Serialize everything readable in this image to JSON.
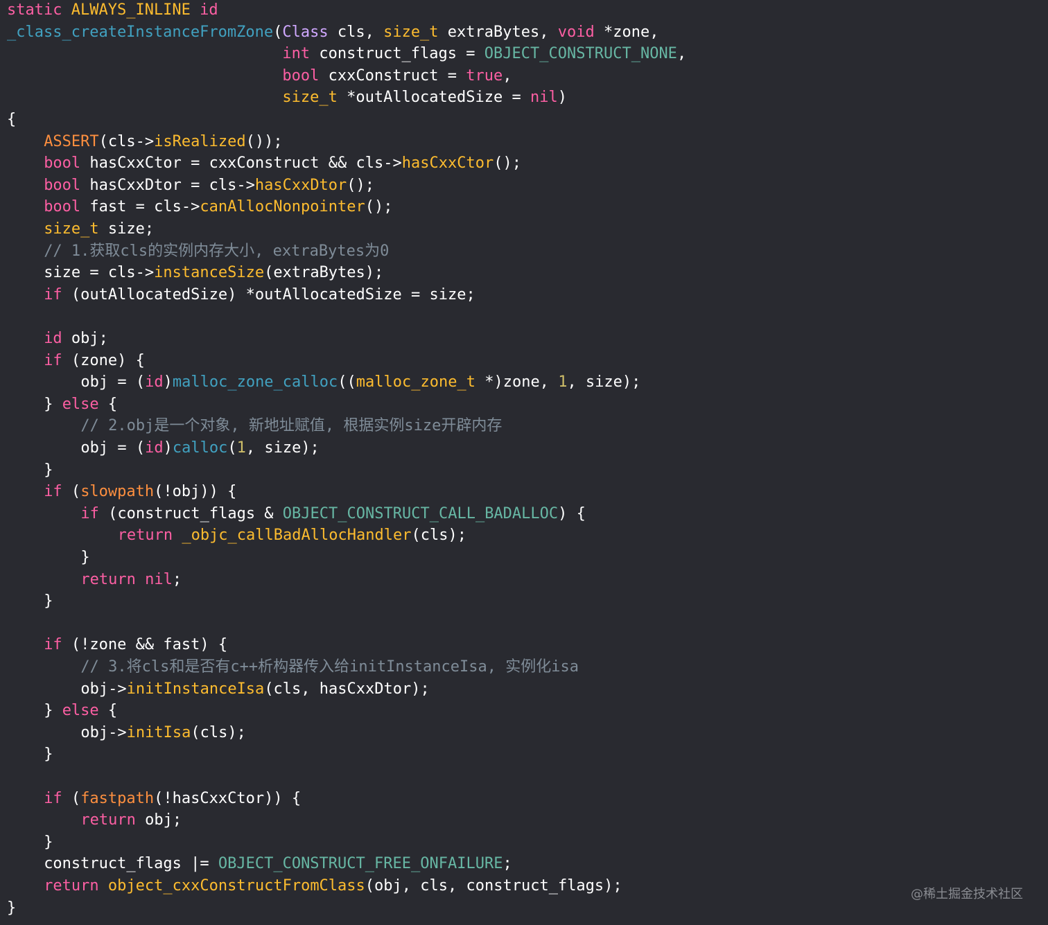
{
  "colors": {
    "background": "#292a30",
    "plain": "#ffffff",
    "keyword": "#fc5fa3",
    "type": "#fd8f3f",
    "function_decl": "#41a1c0",
    "class_name": "#d0a8ff",
    "macro": "#fd8f3f",
    "member_call": "#fdbc2f",
    "constant": "#67b7a4",
    "number": "#d0bf69",
    "comment": "#7f8c98",
    "libcall": "#67b7a4"
  },
  "code": {
    "lines": [
      {
        "indent": 0,
        "tokens": [
          [
            "static",
            "keyword"
          ],
          [
            " ",
            "plain"
          ],
          [
            "ALWAYS_INLINE",
            "member_call"
          ],
          [
            " ",
            "plain"
          ],
          [
            "id",
            "keyword"
          ]
        ]
      },
      {
        "indent": 0,
        "tokens": [
          [
            "_class_createInstanceFromZone",
            "function_decl"
          ],
          [
            "(",
            "plain"
          ],
          [
            "Class",
            "class_name"
          ],
          [
            " cls, ",
            "plain"
          ],
          [
            "size_t",
            "member_call"
          ],
          [
            " extraBytes, ",
            "plain"
          ],
          [
            "void",
            "keyword"
          ],
          [
            " *zone,",
            "plain"
          ]
        ]
      },
      {
        "indent": 0,
        "tokens": [
          [
            "                              ",
            "plain"
          ],
          [
            "int",
            "keyword"
          ],
          [
            " construct_flags = ",
            "plain"
          ],
          [
            "OBJECT_CONSTRUCT_NONE",
            "constant"
          ],
          [
            ",",
            "plain"
          ]
        ]
      },
      {
        "indent": 0,
        "tokens": [
          [
            "                              ",
            "plain"
          ],
          [
            "bool",
            "keyword"
          ],
          [
            " cxxConstruct = ",
            "plain"
          ],
          [
            "true",
            "keyword"
          ],
          [
            ",",
            "plain"
          ]
        ]
      },
      {
        "indent": 0,
        "tokens": [
          [
            "                              ",
            "plain"
          ],
          [
            "size_t",
            "member_call"
          ],
          [
            " *outAllocatedSize = ",
            "plain"
          ],
          [
            "nil",
            "keyword"
          ],
          [
            ")",
            "plain"
          ]
        ]
      },
      {
        "indent": 0,
        "tokens": [
          [
            "{",
            "plain"
          ]
        ]
      },
      {
        "indent": 1,
        "tokens": [
          [
            "ASSERT",
            "macro"
          ],
          [
            "(cls->",
            "plain"
          ],
          [
            "isRealized",
            "member_call"
          ],
          [
            "());",
            "plain"
          ]
        ]
      },
      {
        "indent": 1,
        "tokens": [
          [
            "bool",
            "keyword"
          ],
          [
            " hasCxxCtor = cxxConstruct && cls->",
            "plain"
          ],
          [
            "hasCxxCtor",
            "member_call"
          ],
          [
            "();",
            "plain"
          ]
        ]
      },
      {
        "indent": 1,
        "tokens": [
          [
            "bool",
            "keyword"
          ],
          [
            " hasCxxDtor = cls->",
            "plain"
          ],
          [
            "hasCxxDtor",
            "member_call"
          ],
          [
            "();",
            "plain"
          ]
        ]
      },
      {
        "indent": 1,
        "tokens": [
          [
            "bool",
            "keyword"
          ],
          [
            " fast = cls->",
            "plain"
          ],
          [
            "canAllocNonpointer",
            "member_call"
          ],
          [
            "();",
            "plain"
          ]
        ]
      },
      {
        "indent": 1,
        "tokens": [
          [
            "size_t",
            "member_call"
          ],
          [
            " size;",
            "plain"
          ]
        ]
      },
      {
        "indent": 1,
        "tokens": [
          [
            "// 1.获取cls的实例内存大小, extraBytes为0",
            "comment"
          ]
        ]
      },
      {
        "indent": 1,
        "tokens": [
          [
            "size = cls->",
            "plain"
          ],
          [
            "instanceSize",
            "member_call"
          ],
          [
            "(extraBytes);",
            "plain"
          ]
        ]
      },
      {
        "indent": 1,
        "tokens": [
          [
            "if",
            "keyword"
          ],
          [
            " (outAllocatedSize) *outAllocatedSize = size;",
            "plain"
          ]
        ]
      },
      {
        "indent": 0,
        "tokens": []
      },
      {
        "indent": 1,
        "tokens": [
          [
            "id",
            "keyword"
          ],
          [
            " obj;",
            "plain"
          ]
        ]
      },
      {
        "indent": 1,
        "tokens": [
          [
            "if",
            "keyword"
          ],
          [
            " (zone) {",
            "plain"
          ]
        ]
      },
      {
        "indent": 2,
        "tokens": [
          [
            "obj = (",
            "plain"
          ],
          [
            "id",
            "keyword"
          ],
          [
            ")",
            "plain"
          ],
          [
            "malloc_zone_calloc",
            "function_decl"
          ],
          [
            "((",
            "plain"
          ],
          [
            "malloc_zone_t",
            "member_call"
          ],
          [
            " *)zone, ",
            "plain"
          ],
          [
            "1",
            "number"
          ],
          [
            ", size);",
            "plain"
          ]
        ]
      },
      {
        "indent": 1,
        "tokens": [
          [
            "} ",
            "plain"
          ],
          [
            "else",
            "keyword"
          ],
          [
            " {",
            "plain"
          ]
        ]
      },
      {
        "indent": 2,
        "tokens": [
          [
            "// 2.obj是一个对象, 新地址赋值, 根据实例size开辟内存",
            "comment"
          ]
        ]
      },
      {
        "indent": 2,
        "tokens": [
          [
            "obj = (",
            "plain"
          ],
          [
            "id",
            "keyword"
          ],
          [
            ")",
            "plain"
          ],
          [
            "calloc",
            "function_decl"
          ],
          [
            "(",
            "plain"
          ],
          [
            "1",
            "number"
          ],
          [
            ", size);",
            "plain"
          ]
        ]
      },
      {
        "indent": 1,
        "tokens": [
          [
            "}",
            "plain"
          ]
        ]
      },
      {
        "indent": 1,
        "tokens": [
          [
            "if",
            "keyword"
          ],
          [
            " (",
            "plain"
          ],
          [
            "slowpath",
            "macro"
          ],
          [
            "(!obj)) {",
            "plain"
          ]
        ]
      },
      {
        "indent": 2,
        "tokens": [
          [
            "if",
            "keyword"
          ],
          [
            " (construct_flags & ",
            "plain"
          ],
          [
            "OBJECT_CONSTRUCT_CALL_BADALLOC",
            "constant"
          ],
          [
            ") {",
            "plain"
          ]
        ]
      },
      {
        "indent": 3,
        "tokens": [
          [
            "return",
            "keyword"
          ],
          [
            " ",
            "plain"
          ],
          [
            "_objc_callBadAllocHandler",
            "member_call"
          ],
          [
            "(cls);",
            "plain"
          ]
        ]
      },
      {
        "indent": 2,
        "tokens": [
          [
            "}",
            "plain"
          ]
        ]
      },
      {
        "indent": 2,
        "tokens": [
          [
            "return",
            "keyword"
          ],
          [
            " ",
            "plain"
          ],
          [
            "nil",
            "keyword"
          ],
          [
            ";",
            "plain"
          ]
        ]
      },
      {
        "indent": 1,
        "tokens": [
          [
            "}",
            "plain"
          ]
        ]
      },
      {
        "indent": 0,
        "tokens": []
      },
      {
        "indent": 1,
        "tokens": [
          [
            "if",
            "keyword"
          ],
          [
            " (!zone && fast) {",
            "plain"
          ]
        ]
      },
      {
        "indent": 2,
        "tokens": [
          [
            "// 3.将cls和是否有c++析构器传入给initInstanceIsa, 实例化isa",
            "comment"
          ]
        ]
      },
      {
        "indent": 2,
        "tokens": [
          [
            "obj->",
            "plain"
          ],
          [
            "initInstanceIsa",
            "member_call"
          ],
          [
            "(cls, hasCxxDtor);",
            "plain"
          ]
        ]
      },
      {
        "indent": 1,
        "tokens": [
          [
            "} ",
            "plain"
          ],
          [
            "else",
            "keyword"
          ],
          [
            " {",
            "plain"
          ]
        ]
      },
      {
        "indent": 2,
        "tokens": [
          [
            "obj->",
            "plain"
          ],
          [
            "initIsa",
            "member_call"
          ],
          [
            "(cls);",
            "plain"
          ]
        ]
      },
      {
        "indent": 1,
        "tokens": [
          [
            "}",
            "plain"
          ]
        ]
      },
      {
        "indent": 0,
        "tokens": []
      },
      {
        "indent": 1,
        "tokens": [
          [
            "if",
            "keyword"
          ],
          [
            " (",
            "plain"
          ],
          [
            "fastpath",
            "macro"
          ],
          [
            "(!hasCxxCtor)) {",
            "plain"
          ]
        ]
      },
      {
        "indent": 2,
        "tokens": [
          [
            "return",
            "keyword"
          ],
          [
            " obj;",
            "plain"
          ]
        ]
      },
      {
        "indent": 1,
        "tokens": [
          [
            "}",
            "plain"
          ]
        ]
      },
      {
        "indent": 1,
        "tokens": [
          [
            "construct_flags |= ",
            "plain"
          ],
          [
            "OBJECT_CONSTRUCT_FREE_ONFAILURE",
            "constant"
          ],
          [
            ";",
            "plain"
          ]
        ]
      },
      {
        "indent": 1,
        "tokens": [
          [
            "return",
            "keyword"
          ],
          [
            " ",
            "plain"
          ],
          [
            "object_cxxConstructFromClass",
            "member_call"
          ],
          [
            "(obj, cls, construct_flags);",
            "plain"
          ]
        ]
      },
      {
        "indent": 0,
        "tokens": [
          [
            "}",
            "plain"
          ]
        ]
      }
    ]
  },
  "watermark": {
    "text": "@稀土掘金技术社区"
  }
}
